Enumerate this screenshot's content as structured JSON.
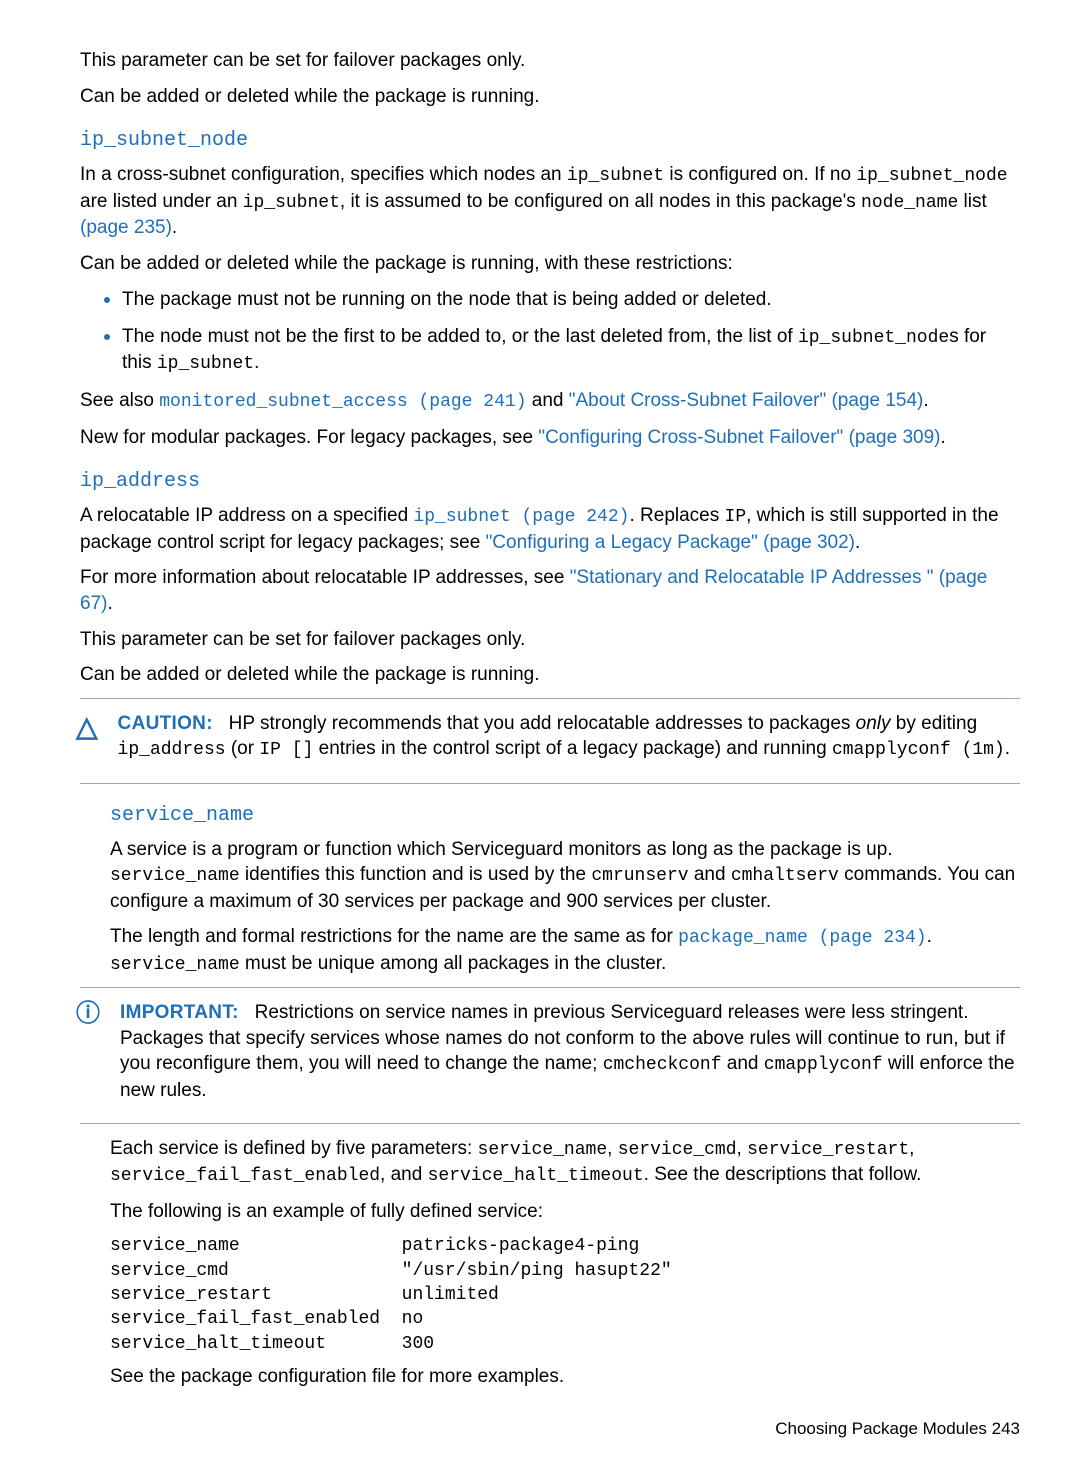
{
  "intro": {
    "p1": "This parameter can be set for failover packages only.",
    "p2": "Can be added or deleted while the package is running."
  },
  "sec1": {
    "heading": "ip_subnet_node",
    "p1a": "In a cross-subnet configuration, specifies which nodes an ",
    "p1b": " is configured on. If no ",
    "p1c": " are listed under an ",
    "p1d": ", it is assumed to be configured on all nodes in this package's ",
    "p1e": " list ",
    "p1link": "(page 235)",
    "p1f": ".",
    "tok_ip_subnet": "ip_subnet",
    "tok_ip_subnet_node": "ip_subnet_node",
    "tok_node_name": "node_name",
    "p2": "Can be added or deleted while the package is running, with these restrictions:",
    "b1": "The package must not be running on the node that is being added or deleted.",
    "b2a": "The node must not be the first to be added to, or the last deleted from, the list of ",
    "b2b": "s for this ",
    "b2c": ".",
    "p3a": "See also ",
    "p3link1": "monitored_subnet_access (page 241)",
    "p3mid": " and ",
    "p3link2": "\"About Cross-Subnet Failover\" (page 154)",
    "p3end": ".",
    "p4a": "New for modular packages. For legacy packages, see ",
    "p4link": "\"Configuring Cross-Subnet Failover\" (page 309)",
    "p4end": "."
  },
  "sec2": {
    "heading": "ip_address",
    "p1a": "A relocatable IP address on a specified ",
    "p1link1": "ip_subnet (page 242)",
    "p1b": ". Replaces ",
    "tok_IP": "IP",
    "p1c": ", which is still supported in the package control script for legacy packages; see ",
    "p1link2": "\"Configuring a Legacy Package\" (page 302)",
    "p1d": ".",
    "p2a": "For more information about relocatable IP addresses, see ",
    "p2link": "\"Stationary and Relocatable IP Addresses \" (page 67)",
    "p2b": ".",
    "p3": "This parameter can be set for failover packages only.",
    "p4": "Can be added or deleted while the package is running."
  },
  "caution": {
    "label": "CAUTION:",
    "t1": "HP strongly recommends that you add relocatable addresses to packages ",
    "em": "only",
    "t2": " by editing ",
    "tok_ip_address": "ip_address",
    "t3": " (or ",
    "tok_ip_arr": "IP []",
    "t4": " entries in the control script of a legacy package) and running ",
    "tok_cmd": "cmapplyconf (1m)",
    "t5": "."
  },
  "sec3": {
    "heading": "service_name",
    "p1a": "A service is a program or function which Serviceguard monitors as long as the package is up. ",
    "tok_service_name": "service_name",
    "p1b": " identifies this function and is used by the ",
    "tok_cmrunserv": "cmrunserv",
    "p1c": " and ",
    "tok_cmhaltserv": "cmhaltserv",
    "p1d": " commands. You can configure a maximum of 30 services per package and 900 services per cluster.",
    "p2a": "The length and formal restrictions for the name are the same as for ",
    "p2link": "package_name (page 234)",
    "p2b": ". ",
    "p2c": " must be unique among all packages in the cluster."
  },
  "important": {
    "label": "IMPORTANT:",
    "t1": "Restrictions on service names in previous Serviceguard releases were less stringent. Packages that specify services whose names do not conform to the above rules will continue to run, but if you reconfigure them, you will need to change the name; ",
    "tok_cmcheckconf": "cmcheckconf",
    "t2": " and ",
    "tok_cmapplyconf": "cmapplyconf",
    "t3": " will enforce the new rules."
  },
  "tail": {
    "p1a": "Each service is defined by five parameters: ",
    "tok1": "service_name",
    "sep1": ", ",
    "tok2": "service_cmd",
    "sep2": ", ",
    "tok3": "service_restart",
    "sep3": ", ",
    "tok4": "service_fail_fast_enabled",
    "sep4": ", and ",
    "tok5": "service_halt_timeout",
    "p1b": ". See the descriptions that follow.",
    "p2": "The following is an example of fully defined service:",
    "code": "service_name               patricks-package4-ping\nservice_cmd                \"/usr/sbin/ping hasupt22\"\nservice_restart            unlimited\nservice_fail_fast_enabled  no\nservice_halt_timeout       300",
    "p3": "See the package configuration file for more examples."
  },
  "footer": "Choosing Package Modules   243"
}
